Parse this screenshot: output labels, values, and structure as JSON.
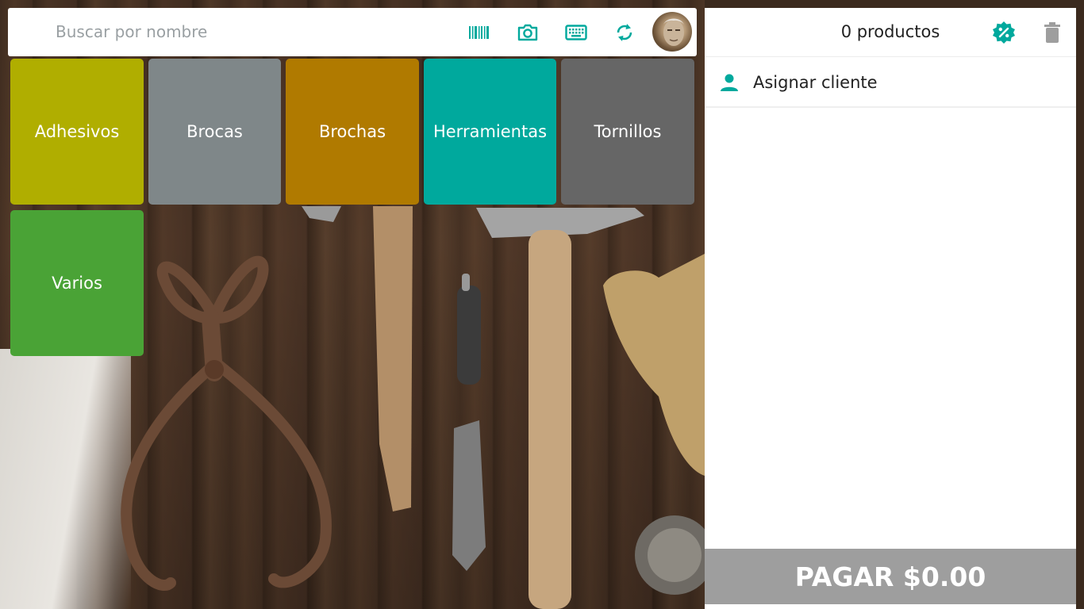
{
  "search": {
    "placeholder": "Buscar por nombre",
    "value": ""
  },
  "toolbar": {
    "icons": [
      "barcode-icon",
      "camera-icon",
      "keyboard-icon",
      "sync-icon"
    ],
    "accent_color": "#00a99d"
  },
  "categories": [
    {
      "label": "Adhesivos",
      "color": "#b0ae00"
    },
    {
      "label": "Brocas",
      "color": "#7f8789"
    },
    {
      "label": "Brochas",
      "color": "#b07a00"
    },
    {
      "label": "Herramientas",
      "color": "#00a99d"
    },
    {
      "label": "Tornillos",
      "color": "#666666"
    },
    {
      "label": "Varios",
      "color": "#4aa336"
    }
  ],
  "cart": {
    "count_label": "0 productos",
    "assign_label": "Asignar cliente",
    "pay_label": "PAGAR $0.00",
    "pay_color": "#9e9e9e"
  }
}
